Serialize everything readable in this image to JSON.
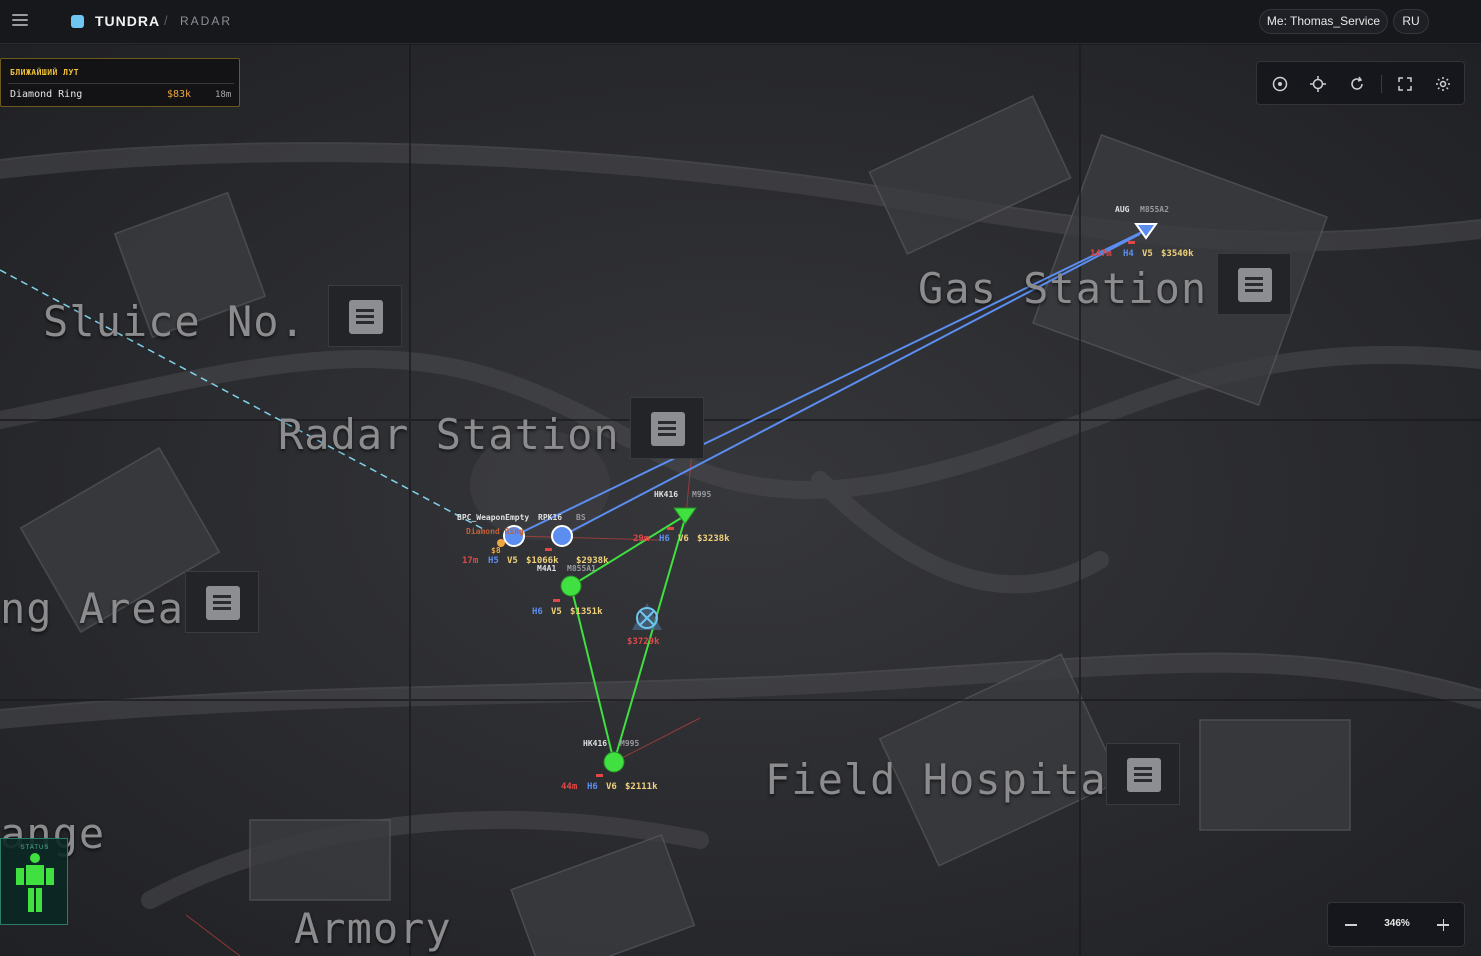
{
  "app": {
    "brand": "TUNDRA",
    "separator": "/",
    "section": "RADAR",
    "user_label": "Me: Thomas_Service",
    "language": "RU"
  },
  "loot_panel": {
    "title": "БЛИЖАЙШИЙ ЛУТ",
    "items": [
      {
        "name": "Diamond Ring",
        "price": "$83k",
        "distance": "18m"
      }
    ]
  },
  "map": {
    "locations": [
      {
        "name": "Sluice No. 2"
      },
      {
        "name": "Radar Station"
      },
      {
        "name": "Gas Station"
      },
      {
        "name": "ng Area"
      },
      {
        "name": "Field Hospital"
      },
      {
        "name": "ange"
      },
      {
        "name": "Armory"
      }
    ],
    "players": [
      {
        "weapon": "AUG",
        "ammo": "M855A2",
        "distance": "147m",
        "helmet": "H4",
        "vest": "V5",
        "value": "$3540k",
        "team": "enemy-blue",
        "color": "#5b8ef0"
      },
      {
        "weapon": "HK416",
        "ammo": "M995",
        "distance": "29m",
        "helmet": "H6",
        "vest": "V6",
        "value": "$3238k",
        "team": "ally-green",
        "color": "#3fe03f"
      },
      {
        "weapon": "M4A1",
        "ammo": "M855A1",
        "distance": "",
        "helmet": "H6",
        "vest": "V5",
        "value": "$1351k",
        "team": "ally-green",
        "color": "#3fe03f"
      },
      {
        "weapon": "HK416",
        "ammo": "M995",
        "distance": "44m",
        "helmet": "H6",
        "vest": "V6",
        "value": "$2111k",
        "team": "ally-green",
        "color": "#3fe03f"
      },
      {
        "weapon": "BPC_WeaponEmpty",
        "ammo": "",
        "distance": "17m",
        "helmet": "H5",
        "vest": "V5",
        "value": "$1066k",
        "team": "enemy-blue",
        "color": "#5b8ef0"
      },
      {
        "weapon": "RPK16",
        "ammo": "BS",
        "distance": "",
        "helmet": "",
        "vest": "",
        "value": "$2938k",
        "team": "enemy-blue",
        "color": "#5b8ef0"
      }
    ],
    "loot_marker": {
      "name": "Diamond Ring",
      "price": "$8"
    },
    "body_marker": {
      "value": "$3729k"
    }
  },
  "toolbar": {
    "buttons": [
      "target-icon",
      "crosshair-icon",
      "refresh-icon",
      "fullscreen-icon",
      "settings-icon"
    ]
  },
  "zoom": {
    "value": "346%",
    "minus": "−",
    "plus": "+"
  },
  "status": {
    "label": "STATUS"
  },
  "colors": {
    "ally": "#3fe03f",
    "enemy": "#5b8ef0",
    "loot": "#f0a640",
    "danger": "#e04848",
    "accent": "#6fc6f0"
  }
}
